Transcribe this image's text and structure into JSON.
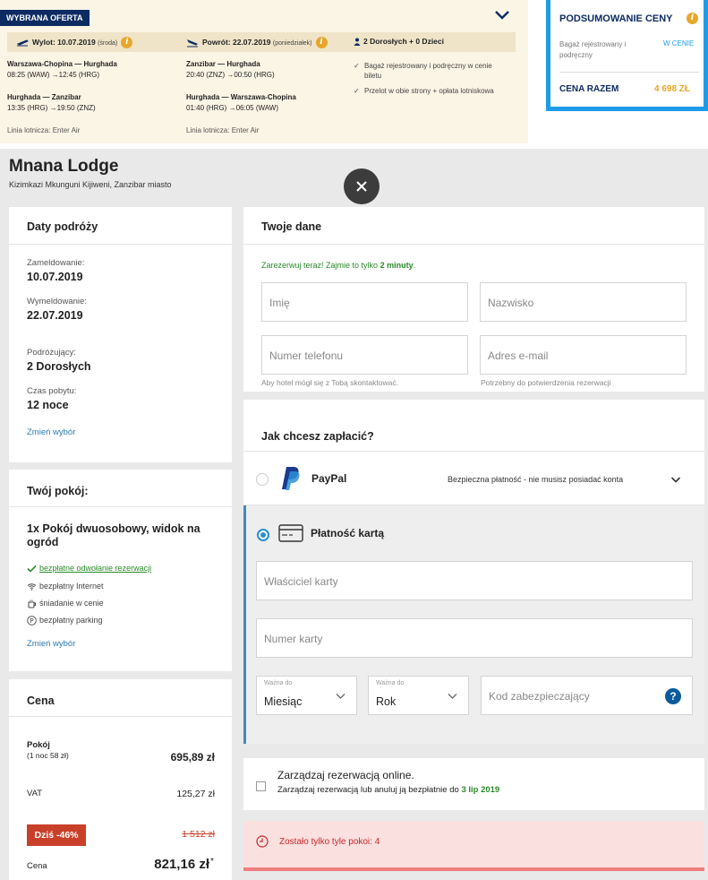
{
  "offer": {
    "tag": "WYBRANA OFERTA",
    "outbound": {
      "label": "Wylot: 10.07.2019",
      "day": "(środa)"
    },
    "return": {
      "label": "Powrót: 22.07.2019",
      "day": "(poniedziałek)"
    },
    "passengers": "2 Dorosłych + 0 Dzieci",
    "out_segments": [
      {
        "route": "Warszawa-Chopina — Hurghada",
        "time": "08:25 (WAW) →12:45 (HRG)"
      },
      {
        "route": "Hurghada — Zanzibar",
        "time": "13:35 (HRG) →19:50 (ZNZ)"
      }
    ],
    "ret_segments": [
      {
        "route": "Zanzibar — Hurghada",
        "time": "20:40 (ZNZ) →00:50 (HRG)"
      },
      {
        "route": "Hurghada — Warszawa-Chopina",
        "time": "01:40 (HRG) →06:05 (WAW)"
      }
    ],
    "airline_out": "Linia lotnicza: Enter Air",
    "airline_ret": "Linia lotnicza: Enter Air",
    "perks": [
      "Bagaż rejestrowany i podręczny w cenie biletu",
      "Przelot w obie strony + opłata lotniskowa"
    ]
  },
  "summary": {
    "title": "PODSUMOWANIE CENY",
    "baggage_label": "Bagaż rejestrowany i podręczny",
    "baggage_value": "W CENIE",
    "total_label": "CENA RAZEM",
    "total_value": "4 698 ZŁ"
  },
  "hotel": {
    "name": "Mnana Lodge",
    "location": "Kizimkazi Mkunguni Kijiweni, Zanzibar miasto"
  },
  "dates": {
    "title": "Daty podróży",
    "checkin_label": "Zameldowanie:",
    "checkin": "10.07.2019",
    "checkout_label": "Wymeldowanie:",
    "checkout": "22.07.2019",
    "travelers_label": "Podróżujący:",
    "travelers": "2 Dorosłych",
    "stay_label": "Czas pobytu:",
    "stay": "12 noce",
    "change": "Zmień wybór"
  },
  "room": {
    "title": "Twój pokój:",
    "name": "1x Pokój dwuosobowy, widok na ogród",
    "amenities": [
      {
        "icon": "check-icon",
        "text": "bezpłatne odwołanie rezerwacji"
      },
      {
        "icon": "wifi-icon",
        "text": "bezpłatny Internet"
      },
      {
        "icon": "breakfast-icon",
        "text": "śniadanie w cenie"
      },
      {
        "icon": "parking-icon",
        "text": "bezpłatny parking"
      }
    ],
    "change": "Zmień wybór"
  },
  "price": {
    "title": "Cena",
    "room_label": "Pokój",
    "room_sub": "(1 noc 58 zł)",
    "room_value": "695,89 zł",
    "vat_label": "VAT",
    "vat_value": "125,27 zł",
    "discount_badge": "Dziś -46%",
    "old_price": "1 512 zł",
    "final_label": "Cena",
    "final_value": "821,16 zł",
    "final_mark": "*"
  },
  "form": {
    "title": "Twoje dane",
    "promo_prefix": "Zarezerwuj teraz! Zajmie to tylko",
    "promo_strong": "2 minuty",
    "promo_suffix": ".",
    "first_name": "Imię",
    "last_name": "Nazwisko",
    "phone": "Numer telefonu",
    "email": "Adres e-mail",
    "phone_hint": "Aby hotel mógł się z Tobą skontaktować.",
    "email_hint": "Potrzebny do potwierdzenia rezerwacji"
  },
  "payment": {
    "title": "Jak chcesz zapłacić?",
    "paypal_label": "PayPal",
    "paypal_note": "Bezpieczna płatność - nie musisz posiadać konta",
    "card_label": "Płatność kartą",
    "card_owner": "Właściciel karty",
    "card_number": "Numer karty",
    "valid_label": "Ważna do",
    "month": "Miesiąc",
    "year": "Rok",
    "cvv": "Kod zabezpieczający",
    "help": "?"
  },
  "manage": {
    "title": "Zarządzaj rezerwacją online.",
    "desc_prefix": "Zarządzaj rezerwacją lub anuluj ją bezpłatnie do",
    "desc_date": "3 lip 2019"
  },
  "alert": {
    "text": "Zostało tylko tyle pokoi: 4"
  },
  "colors": {
    "navy": "#0d2b63",
    "blue": "#1e9be8",
    "orange": "#e6a72a",
    "green": "#2a8a2a",
    "discount": "#c9402a",
    "alert": "#c62828"
  }
}
